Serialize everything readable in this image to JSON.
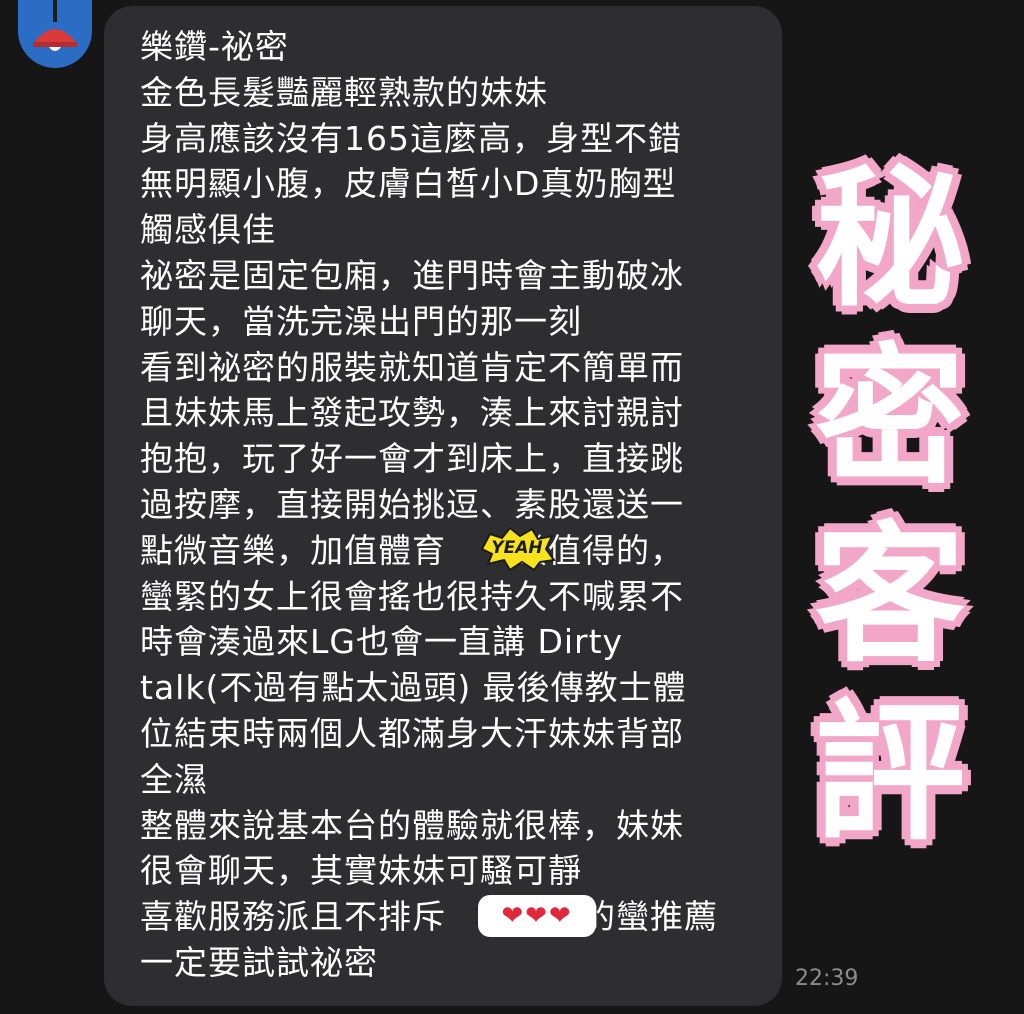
{
  "message": {
    "lines": [
      "樂鑽-祕密",
      "金色長髮豔麗輕熟款的妹妹",
      "身高應該沒有165這麼高，身型不錯",
      "無明顯小腹，皮膚白皙小D真奶胸型",
      "觸感俱佳",
      "祕密是固定包廂，進門時會主動破冰",
      "聊天，當洗完澡出門的那一刻",
      "看到祕密的服裝就知道肯定不簡單而",
      "且妹妹馬上發起攻勢，湊上來討親討",
      "抱抱，玩了好一會才到床上，直接跳",
      "過按摩，直接開始挑逗、素股還送一",
      "點微音樂，加值體育　　蠻值得的，",
      "蠻緊的女上很會搖也很持久不喊累不",
      "時會湊過來LG也會一直講 Dirty",
      "talk(不過有點太過頭) 最後傳教士體",
      "位結束時兩個人都滿身大汗妹妹背部",
      "全濕",
      "整體來說基本台的體驗就很棒，妹妹",
      "很會聊天，其實妹妹可騷可靜",
      "喜歡服務派且不排斥　　　　的蠻推薦",
      "一定要試試祕密"
    ],
    "timestamp": "22:39"
  },
  "stickers": {
    "title_chars": [
      "秘",
      "密",
      "客",
      "評"
    ],
    "yeah_label": "YEAH",
    "hearts_label": "❤❤❤"
  },
  "colors": {
    "background": "#161617",
    "bubble": "#2e2e30",
    "text": "#ffffff",
    "timestamp": "#8c8c8e",
    "avatar": "#2b6dc4",
    "sticker_outline": "#f3a7c8",
    "yeah_fill": "#f7e21b"
  },
  "icons": {
    "avatar": "red-lamp-icon"
  }
}
